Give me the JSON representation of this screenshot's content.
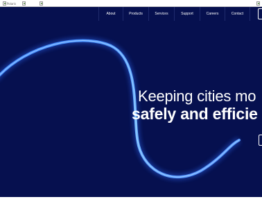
{
  "header": {
    "logo_alt": "Polaris",
    "broken_images": [
      "",
      ""
    ],
    "corner_image_alt": ""
  },
  "nav": {
    "items": [
      {
        "label": "About"
      },
      {
        "label": "Products"
      },
      {
        "label": "Services"
      },
      {
        "label": "Support"
      },
      {
        "label": "Careers"
      },
      {
        "label": "Contact"
      }
    ]
  },
  "hero": {
    "headline_line1": "Keeping cities mo",
    "headline_line2": "safely and efficie",
    "background_color": "#06104f",
    "accent_line_color": "#5aa8ff"
  }
}
